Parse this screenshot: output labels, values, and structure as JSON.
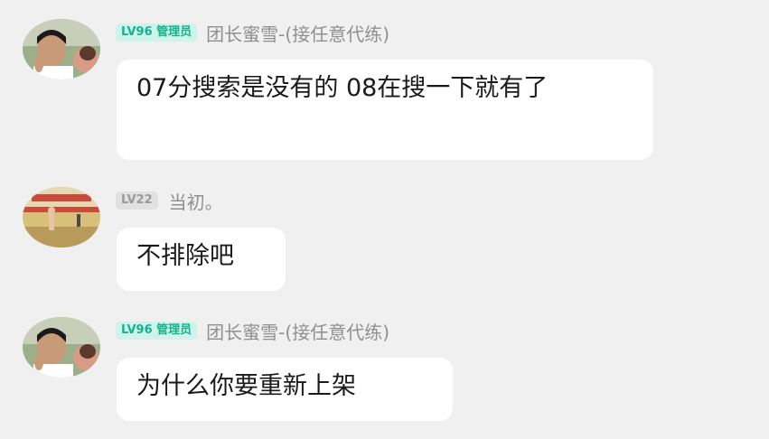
{
  "messages": [
    {
      "badge": "LV96 管理员",
      "badge_type": "admin",
      "username": "团长蜜雪-(接任意代练)",
      "avatar": "person-avatar-icon",
      "text": "07分搜索是没有的  08在搜一下就有了"
    },
    {
      "badge": "LV22",
      "badge_type": "plain",
      "username": "当初。",
      "avatar": "stage-event-avatar-icon",
      "text": "不排除吧"
    },
    {
      "badge": "LV96 管理员",
      "badge_type": "admin",
      "username": "团长蜜雪-(接任意代练)",
      "avatar": "person-avatar-icon",
      "text": "为什么你要重新上架"
    }
  ],
  "colors": {
    "background": "#f0f0f0",
    "admin_badge_bg": "#cdf3ea",
    "admin_badge_text": "#14b28d",
    "plain_badge_bg": "#e1e1e1",
    "plain_badge_text": "#9a9a9a",
    "username_text": "#8f8f8f",
    "bubble_bg": "#ffffff"
  }
}
